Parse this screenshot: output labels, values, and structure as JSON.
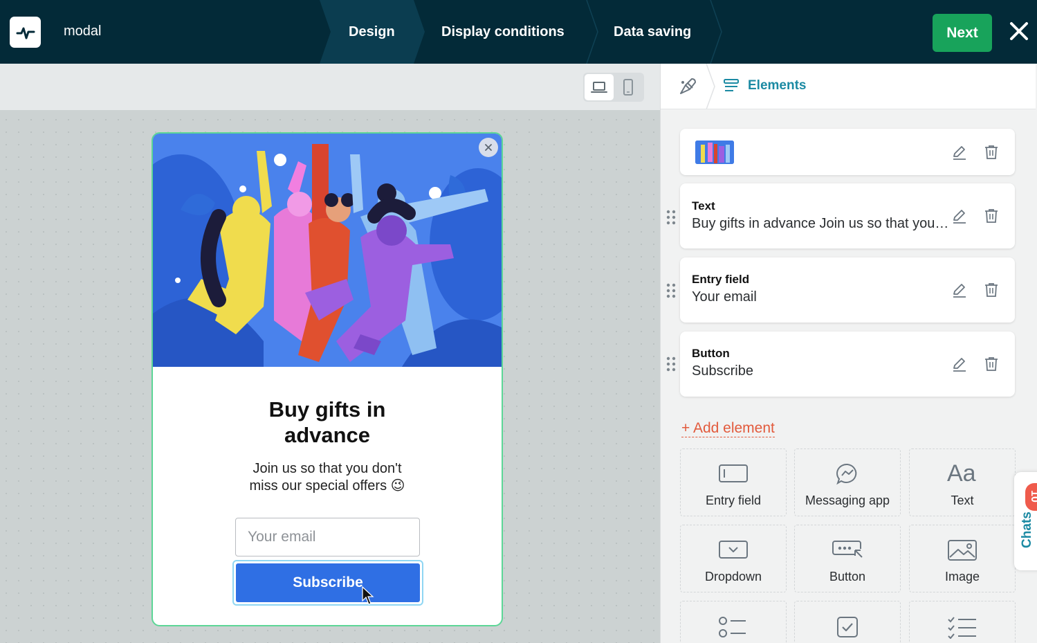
{
  "app": {
    "title": "modal"
  },
  "steps": [
    {
      "label": "Design",
      "active": true
    },
    {
      "label": "Display conditions",
      "active": false
    },
    {
      "label": "Data saving",
      "active": false
    }
  ],
  "topbar": {
    "next_label": "Next"
  },
  "preview": {
    "title_line1": "Buy gifts in",
    "title_line2": "advance",
    "subtitle_line1": "Join us so that you don't",
    "subtitle_line2": "miss our special offers 😉",
    "input_placeholder": "Your email",
    "button_label": "Subscribe"
  },
  "panel": {
    "breadcrumb_label": "Elements",
    "elements": [
      {
        "type": "Image",
        "value": ""
      },
      {
        "type": "Text",
        "value": "Buy gifts in advance Join us so that you don't miss our special offers"
      },
      {
        "type": "Entry field",
        "value": "Your email"
      },
      {
        "type": "Button",
        "value": "Subscribe"
      }
    ],
    "add_element_label": "+ Add element",
    "tiles": [
      {
        "label": "Entry field",
        "icon": "entry-field-icon"
      },
      {
        "label": "Messaging app",
        "icon": "messaging-app-icon"
      },
      {
        "label": "Text",
        "icon": "text-icon"
      },
      {
        "label": "Dropdown",
        "icon": "dropdown-icon"
      },
      {
        "label": "Button",
        "icon": "button-icon"
      },
      {
        "label": "Image",
        "icon": "image-icon"
      },
      {
        "label": "",
        "icon": "radio-list-icon"
      },
      {
        "label": "",
        "icon": "checkbox-icon"
      },
      {
        "label": "",
        "icon": "checklist-icon"
      }
    ]
  },
  "chats": {
    "label": "Chats",
    "count": "10"
  },
  "colors": {
    "topbar": "#032a38",
    "accent_green": "#18a35b",
    "subscribe_blue": "#2f6fe4",
    "link_teal": "#1b8aa3",
    "add_element_red": "#e25a3c"
  }
}
